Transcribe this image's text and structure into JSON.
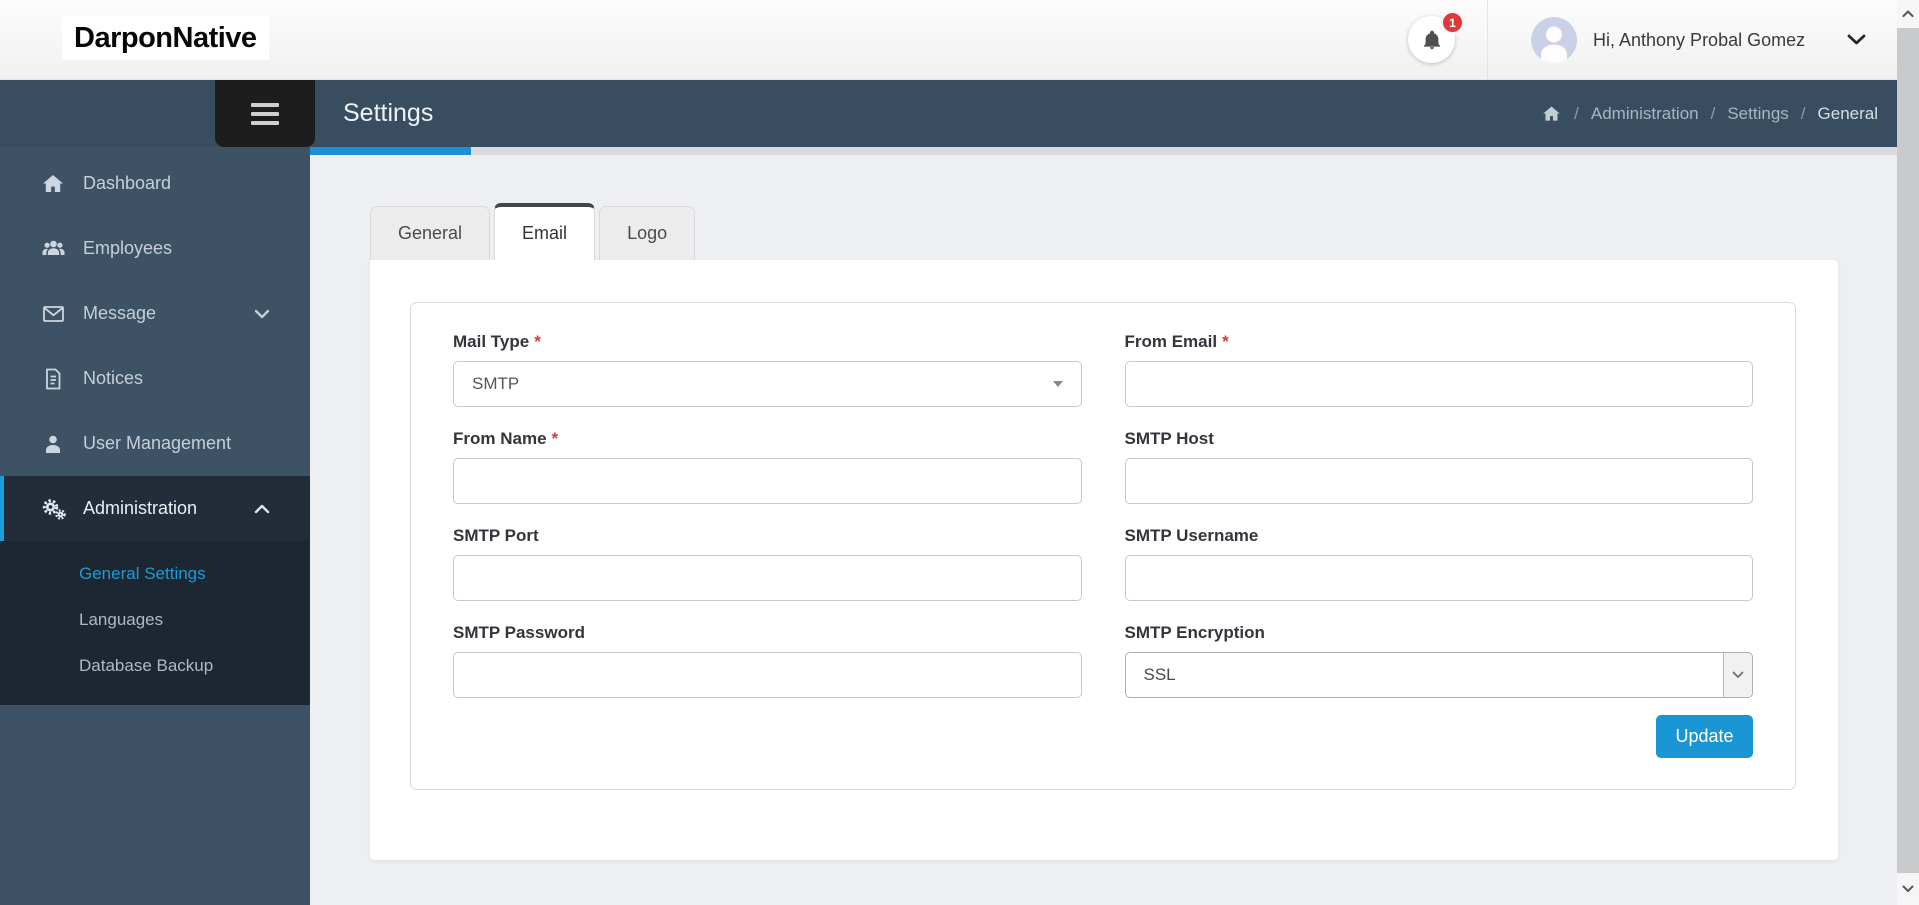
{
  "colors": {
    "accent_blue": "#1b9cd9",
    "navbar_bg": "#394d61",
    "sidebar_bg": "#3d5265",
    "sidebar_active_bg": "#222d39",
    "submenu_bg": "#1d2731",
    "update_button": "#1996d3",
    "badge_red": "#dc3a3a",
    "tab_active_top_border": "#40464d"
  },
  "header": {
    "logo": "DarponNative",
    "notification_count": "1",
    "bell_icon": "bell-icon",
    "greeting": "Hi, Anthony Probal Gomez",
    "caret_icon": "chevron-down-icon"
  },
  "navbar": {
    "title": "Settings",
    "menu_icon": "hamburger-icon",
    "breadcrumb": {
      "home_icon": "home-icon",
      "separator": "/",
      "items": [
        "Administration",
        "Settings",
        "General"
      ]
    }
  },
  "sidebar": {
    "items": [
      {
        "label": "Dashboard",
        "icon": "home-icon"
      },
      {
        "label": "Employees",
        "icon": "users-icon"
      },
      {
        "label": "Message",
        "icon": "envelope-icon",
        "chevron": "down"
      },
      {
        "label": "Notices",
        "icon": "document-icon"
      },
      {
        "label": "User Management",
        "icon": "user-icon"
      },
      {
        "label": "Administration",
        "icon": "gears-icon",
        "chevron": "up",
        "active": true
      }
    ],
    "administration_submenu": [
      {
        "label": "General Settings",
        "active": true
      },
      {
        "label": "Languages"
      },
      {
        "label": "Database Backup"
      }
    ]
  },
  "tabs": [
    {
      "label": "General"
    },
    {
      "label": "Email",
      "active": true
    },
    {
      "label": "Logo"
    }
  ],
  "form": {
    "fields": [
      {
        "label": "Mail Type",
        "required": "*",
        "control": "select2",
        "value": "SMTP"
      },
      {
        "label": "From Email",
        "required": "*",
        "control": "text",
        "value": ""
      },
      {
        "label": "From Name",
        "required": "*",
        "control": "text",
        "value": ""
      },
      {
        "label": "SMTP Host",
        "control": "text",
        "value": ""
      },
      {
        "label": "SMTP Port",
        "control": "text",
        "value": ""
      },
      {
        "label": "SMTP Username",
        "control": "text",
        "value": ""
      },
      {
        "label": "SMTP Password",
        "control": "text",
        "value": ""
      },
      {
        "label": "SMTP Encryption",
        "control": "select",
        "value": "SSL"
      }
    ],
    "submit_label": "Update"
  }
}
